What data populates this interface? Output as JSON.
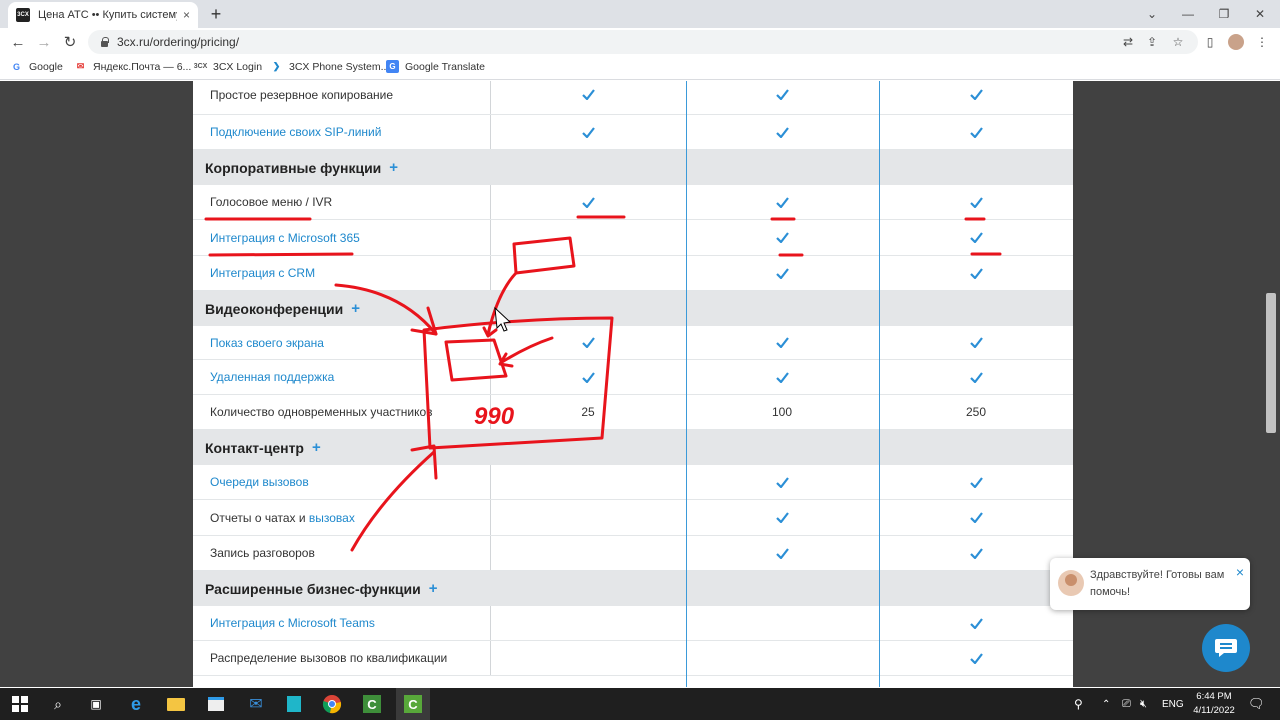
{
  "browser": {
    "tab_title": "Цена АТС •• Купить систему те",
    "tab_close": "×",
    "new_tab": "+",
    "url": "3cx.ru/ordering/pricing/",
    "favicon_text": "3CX",
    "bookmarks": [
      {
        "label": "Google",
        "icon": "google-icon"
      },
      {
        "label": "Яндекс.Почта — 6...",
        "icon": "yandex-mail-icon"
      },
      {
        "label": "3CX Login",
        "icon": "3cx-icon"
      },
      {
        "label": "3CX Phone System...",
        "icon": "3cx-arrow-icon"
      },
      {
        "label": "Google Translate",
        "icon": "translate-icon"
      }
    ]
  },
  "features": {
    "rows": [
      {
        "kind": "feature",
        "label": "Простое резервное копирование",
        "link": false,
        "c1": "check",
        "c2": "check",
        "c3": "check"
      },
      {
        "kind": "feature",
        "label": "Подключение своих SIP-линий",
        "link": true,
        "c1": "check",
        "c2": "check",
        "c3": "check"
      },
      {
        "kind": "section",
        "label": "Корпоративные функции",
        "plus": "+"
      },
      {
        "kind": "feature",
        "label": "Голосовое меню / IVR",
        "link": false,
        "c1": "check",
        "c2": "check",
        "c3": "check"
      },
      {
        "kind": "feature",
        "label_prefix": "Интеграция с ",
        "label_link": "Microsoft 365",
        "link": true,
        "c1": "",
        "c2": "check",
        "c3": "check"
      },
      {
        "kind": "feature",
        "label": "Интеграция с CRM",
        "link": true,
        "c1": "",
        "c2": "check",
        "c3": "check"
      },
      {
        "kind": "section",
        "label": "Видеоконференции",
        "plus": "+"
      },
      {
        "kind": "feature",
        "label": "Показ своего экрана",
        "link": true,
        "c1": "check",
        "c2": "check",
        "c3": "check"
      },
      {
        "kind": "feature",
        "label": "Удаленная поддержка",
        "link": true,
        "c1": "check",
        "c2": "check",
        "c3": "check"
      },
      {
        "kind": "feature",
        "label": "Количество одновременных участников",
        "link": false,
        "c1": "25",
        "c2": "100",
        "c3": "250"
      },
      {
        "kind": "section",
        "label": "Контакт-центр",
        "plus": "+"
      },
      {
        "kind": "feature",
        "label": "Очереди вызовов",
        "link": true,
        "c1": "",
        "c2": "check",
        "c3": "check"
      },
      {
        "kind": "feature",
        "label_prefix": "Отчеты о чатах и ",
        "label_link": "вызовах",
        "link": false,
        "c1": "",
        "c2": "check",
        "c3": "check"
      },
      {
        "kind": "feature",
        "label": "Запись разговоров",
        "link": false,
        "c1": "",
        "c2": "check",
        "c3": "check"
      },
      {
        "kind": "section",
        "label": "Расширенные бизнес-функции",
        "plus": "+"
      },
      {
        "kind": "feature",
        "label": "Интеграция с Microsoft Teams",
        "link": true,
        "c1": "",
        "c2": "",
        "c3": "check"
      },
      {
        "kind": "feature",
        "label": "Распределение вызовов по квалификации",
        "link": false,
        "c1": "",
        "c2": "",
        "c3": "check"
      }
    ]
  },
  "chat": {
    "message": "Здравствуйте! Готовы вам помочь!",
    "close": "×"
  },
  "annotation": {
    "scribble_text": "990"
  },
  "taskbar": {
    "lang": "ENG",
    "time": "6:44 PM",
    "date": "4/11/2022"
  },
  "colors": {
    "accent": "#1e88cc",
    "check": "#2b8fd6",
    "section_bg": "#e4e6e8",
    "page_bg": "#414141",
    "annotation": "#e8141c"
  }
}
